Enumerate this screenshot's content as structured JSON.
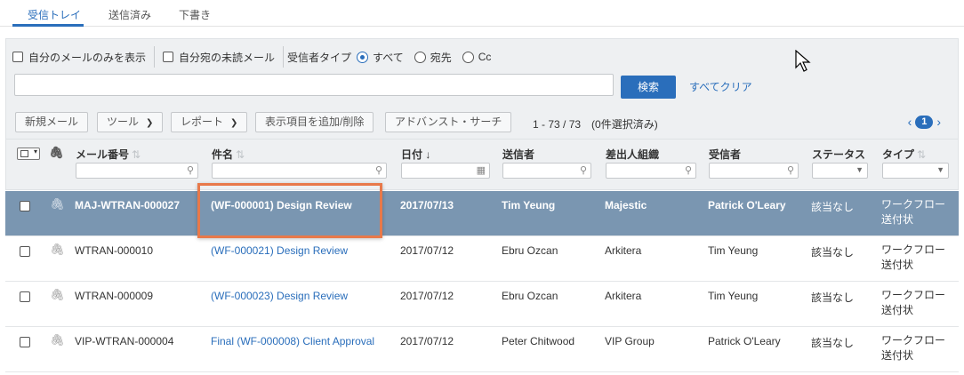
{
  "tabs": [
    {
      "label": "受信トレイ",
      "active": true
    },
    {
      "label": "送信済み",
      "active": false
    },
    {
      "label": "下書き",
      "active": false
    }
  ],
  "filters": {
    "only_mine": "自分のメールのみを表示",
    "unread_to_me": "自分宛の未読メール",
    "recipient_type_label": "受信者タイプ",
    "radio_all": "すべて",
    "radio_to": "宛先",
    "radio_cc": "Cc",
    "search_value": "",
    "search_button": "検索",
    "clear_all": "すべてクリア"
  },
  "toolbar": {
    "new_mail": "新規メール",
    "tools": "ツール",
    "reports": "レポート",
    "add_remove_columns": "表示項目を追加/削除",
    "advanced_search": "アドバンスト・サーチ",
    "count": "1 - 73 / 73　(0件選択済み)",
    "page": "1"
  },
  "columns": {
    "mail_no": "メール番号",
    "subject": "件名",
    "date": "日付 ↓",
    "sender": "送信者",
    "sender_org": "差出人組織",
    "recipient": "受信者",
    "status": "ステータス",
    "type": "タイプ"
  },
  "rows": [
    {
      "mail_no": "MAJ-WTRAN-000027",
      "subject": "(WF-000001) Design Review",
      "date": "2017/07/13",
      "sender": "Tim Yeung",
      "org": "Majestic",
      "recipient": "Patrick O'Leary",
      "status": "該当なし",
      "type1": "ワークフロー",
      "type2": "送付状"
    },
    {
      "mail_no": "WTRAN-000010",
      "subject": "(WF-000021) Design Review",
      "date": "2017/07/12",
      "sender": "Ebru Ozcan",
      "org": "Arkitera",
      "recipient": "Tim Yeung",
      "status": "該当なし",
      "type1": "ワークフロー",
      "type2": "送付状"
    },
    {
      "mail_no": "WTRAN-000009",
      "subject": "(WF-000023) Design Review",
      "date": "2017/07/12",
      "sender": "Ebru Ozcan",
      "org": "Arkitera",
      "recipient": "Tim Yeung",
      "status": "該当なし",
      "type1": "ワークフロー",
      "type2": "送付状"
    },
    {
      "mail_no": "VIP-WTRAN-000004",
      "subject": "Final (WF-000008) Client Approval",
      "date": "2017/07/12",
      "sender": "Peter Chitwood",
      "org": "VIP Group",
      "recipient": "Patrick O'Leary",
      "status": "該当なし",
      "type1": "ワークフロー",
      "type2": "送付状"
    }
  ],
  "colors": {
    "accent": "#2a6ebb",
    "selected_row": "#7a96b1",
    "highlight": "#e8794a"
  }
}
